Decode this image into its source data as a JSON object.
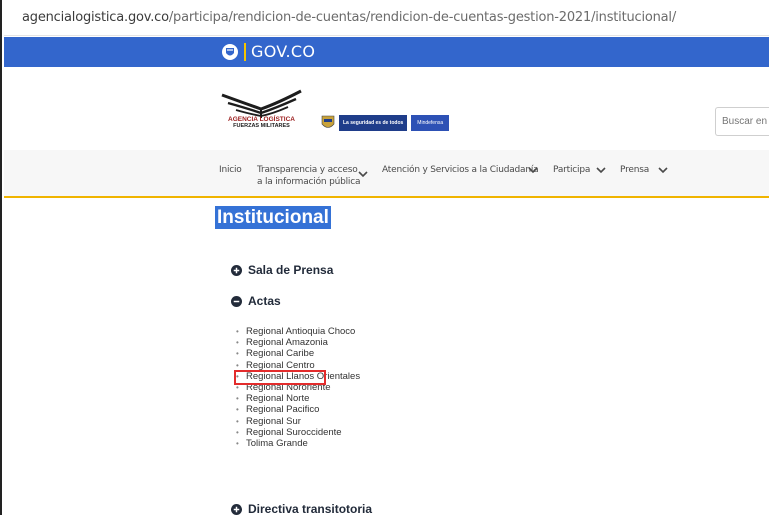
{
  "browser": {
    "url_main": "agencialogistica.gov.co",
    "url_path": "/participa/rendicion-de-cuentas/rendicion-de-cuentas-gestion-2021/institucional/"
  },
  "gov_bar": {
    "label": "GOV.CO",
    "color": "#3366cc"
  },
  "header": {
    "agency_name": "AGENCIA LOGÍSTICA",
    "agency_sub": "FUERZAS MILITARES",
    "mindef_slogan": "La seguridad es de todos",
    "mindef_name": "Mindefensa",
    "search_placeholder": "Buscar en s"
  },
  "nav": {
    "inicio": "Inicio",
    "transparencia_line1": "Transparencia y acceso",
    "transparencia_line2": "a la información pública",
    "atencion": "Atención y Servicios a la Ciudadanía",
    "participa": "Participa",
    "prensa": "Prensa"
  },
  "main": {
    "title": "Institucional",
    "sections": {
      "sala_prensa": "Sala de Prensa",
      "actas": "Actas",
      "directiva": "Directiva transitotoria"
    },
    "actas_items": [
      "Regional Antioquia Choco",
      "Regional Amazonia",
      "Regional Caribe",
      "Regional Centro",
      "Regional Llanos Orientales",
      "Regional Nororiente",
      "Regional Norte",
      "Regional Pacifico",
      "Regional Sur",
      "Regional Suroccidente",
      "Tolima Grande"
    ]
  },
  "colors": {
    "accent": "#3572d6",
    "nav_border": "#f0b400",
    "highlight": "#e32c2c"
  }
}
